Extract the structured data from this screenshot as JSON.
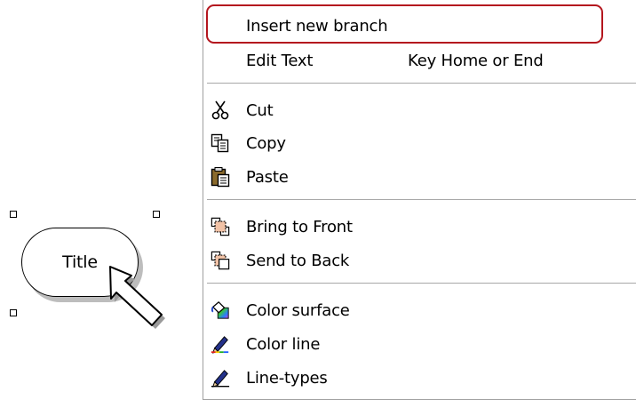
{
  "shape": {
    "label": "Title"
  },
  "menu": {
    "items": [
      {
        "id": "insert-new-branch",
        "label": "Insert new branch",
        "shortcut": "",
        "icon": ""
      },
      {
        "id": "edit-text",
        "label": "Edit Text",
        "shortcut": "Key Home or End",
        "icon": ""
      },
      {
        "id": "cut",
        "label": "Cut",
        "shortcut": "",
        "icon": "scissors-icon"
      },
      {
        "id": "copy",
        "label": "Copy",
        "shortcut": "",
        "icon": "copy-icon"
      },
      {
        "id": "paste",
        "label": "Paste",
        "shortcut": "",
        "icon": "paste-icon"
      },
      {
        "id": "bring-to-front",
        "label": "Bring to Front",
        "shortcut": "",
        "icon": "bring-to-front-icon"
      },
      {
        "id": "send-to-back",
        "label": "Send to Back",
        "shortcut": "",
        "icon": "send-to-back-icon"
      },
      {
        "id": "color-surface",
        "label": "Color surface",
        "shortcut": "",
        "icon": "paint-bucket-icon"
      },
      {
        "id": "color-line",
        "label": "Color line",
        "shortcut": "",
        "icon": "pen-color-icon"
      },
      {
        "id": "line-types",
        "label": "Line-types",
        "shortcut": "",
        "icon": "pen-linetype-icon"
      }
    ]
  },
  "colors": {
    "highlight_border": "#b4161e",
    "separator": "#a8a8a8"
  }
}
